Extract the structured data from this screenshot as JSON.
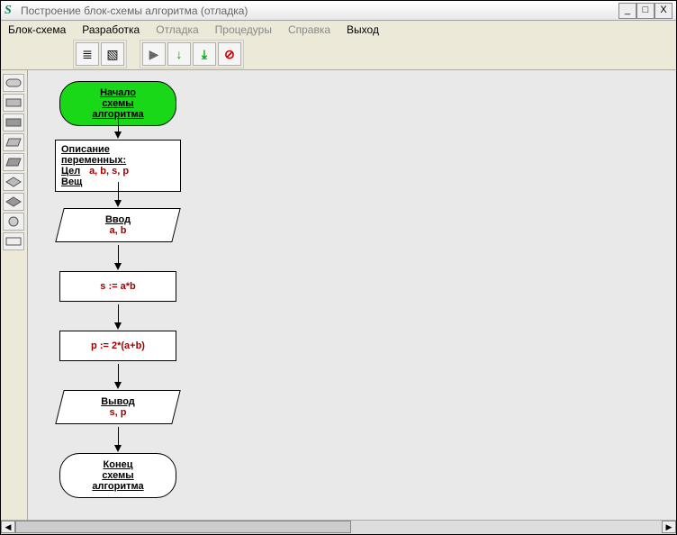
{
  "window": {
    "title": "Построение блок-схемы алгоритма (отладка)"
  },
  "menu": {
    "blok": "Блок-схема",
    "razr": "Разработка",
    "otl": "Отладка",
    "proc": "Процедуры",
    "sprav": "Справка",
    "vyhod": "Выход"
  },
  "toolbar_icons": {
    "group1a": "≣",
    "group1b": "▧",
    "play": "▶",
    "stepin": "↓",
    "stepover": "⤓",
    "stop": "⊘"
  },
  "palette": [
    "term",
    "proc",
    "proc",
    "para",
    "para",
    "diamond",
    "diamond",
    "circle",
    "rect"
  ],
  "flow": {
    "start1": "Начало",
    "start2": "схемы алгоритма",
    "decl_h": "Описание переменных:",
    "decl_t1": "Цел",
    "decl_v1": "a, b, s, p",
    "decl_t2": "Вещ",
    "in_lbl": "Ввод",
    "in_val": "a, b",
    "p1": "s := a*b",
    "p2": "p := 2*(a+b)",
    "out_lbl": "Вывод",
    "out_val": "s, p",
    "end1": "Конец",
    "end2": "схемы алгоритма"
  }
}
